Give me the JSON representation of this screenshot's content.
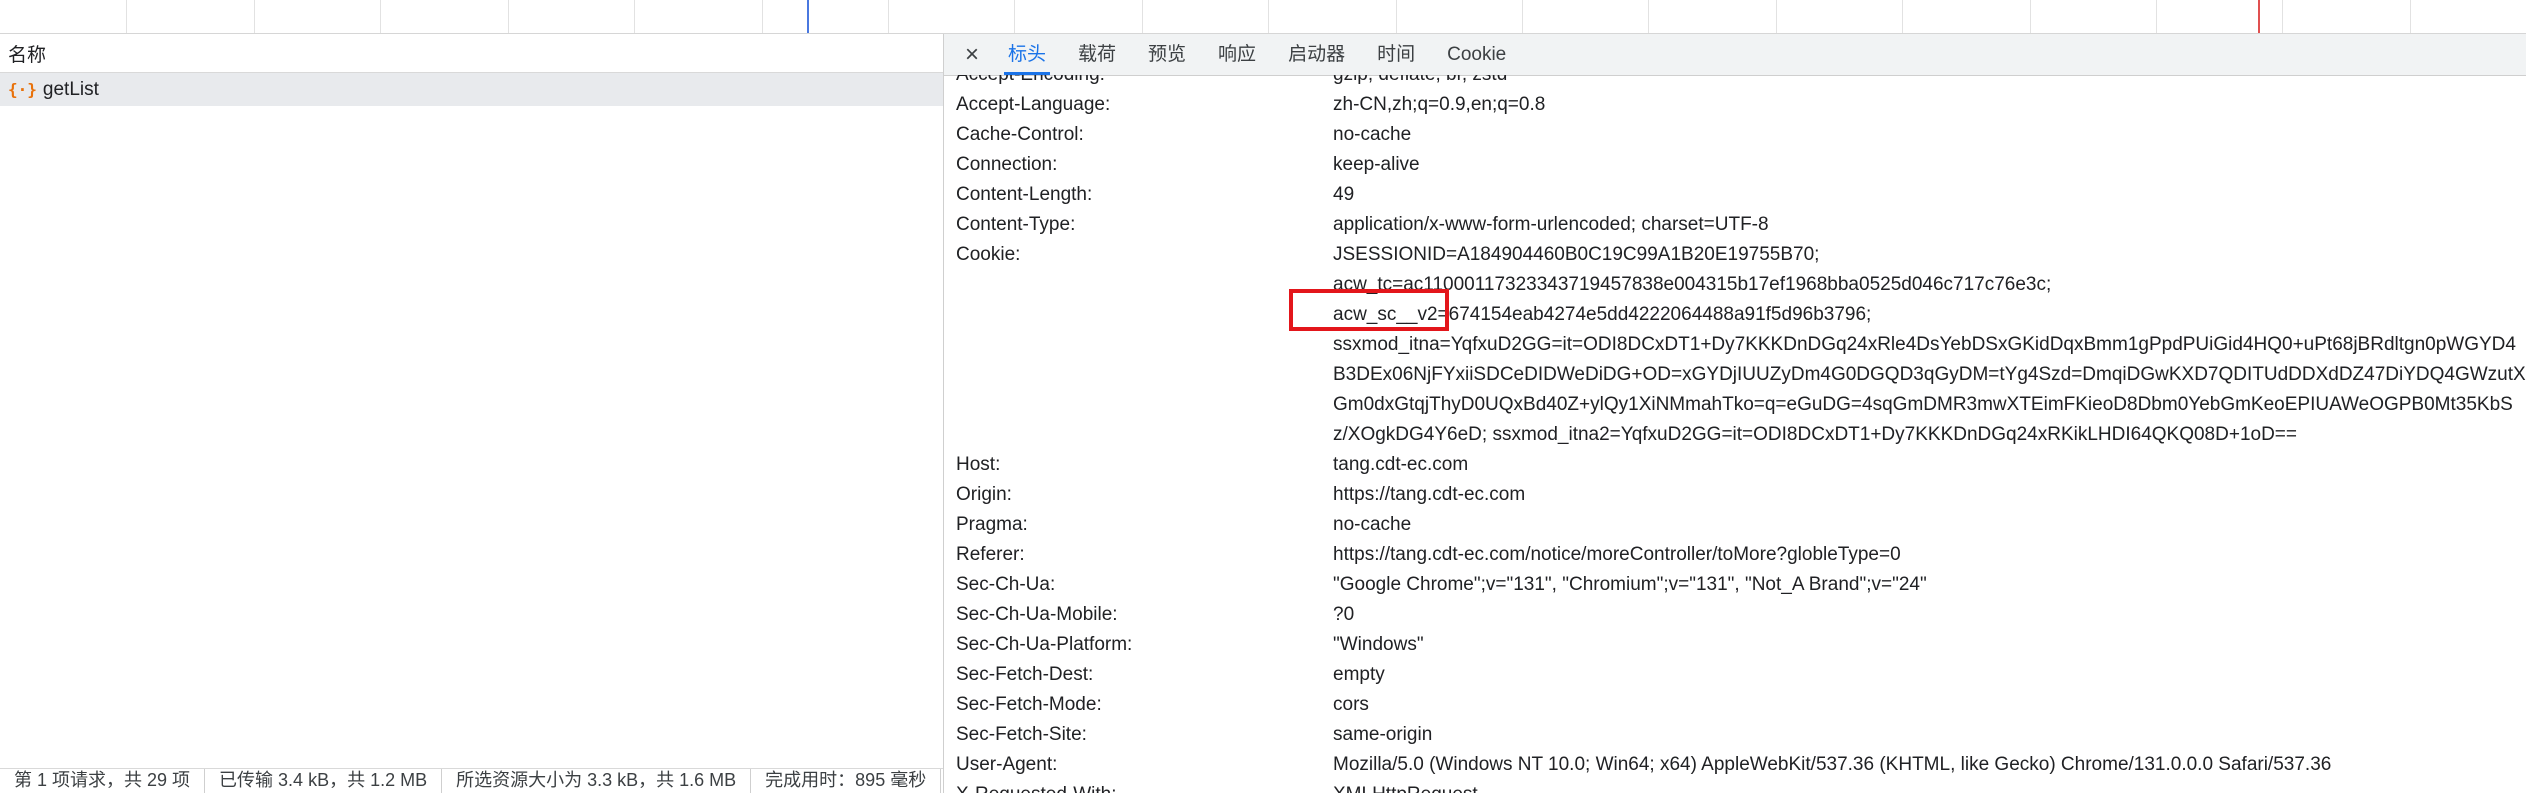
{
  "left": {
    "header": "名称",
    "request_name": "getList",
    "request_icon": "{·}",
    "status": [
      "第 1 项请求，共 29 项",
      "已传输 3.4 kB，共 1.2 MB",
      "所选资源大小为 3.3 kB，共 1.6 MB",
      "完成用时：895 毫秒"
    ]
  },
  "tabs": [
    "标头",
    "载荷",
    "预览",
    "响应",
    "启动器",
    "时间",
    "Cookie"
  ],
  "active_tab": "标头",
  "close_icon": "×",
  "headers": [
    {
      "key": "Accept-Encoding:",
      "value": "gzip, deflate, br, zstd"
    },
    {
      "key": "Accept-Language:",
      "value": "zh-CN,zh;q=0.9,en;q=0.8"
    },
    {
      "key": "Cache-Control:",
      "value": "no-cache"
    },
    {
      "key": "Connection:",
      "value": "keep-alive"
    },
    {
      "key": "Content-Length:",
      "value": "49"
    },
    {
      "key": "Content-Type:",
      "value": "application/x-www-form-urlencoded; charset=UTF-8"
    },
    {
      "key": "Cookie:",
      "value": "JSESSIONID=A184904460B0C19C99A1B20E19755B70;"
    },
    {
      "key": "Host:",
      "value": "tang.cdt-ec.com"
    },
    {
      "key": "Origin:",
      "value": "https://tang.cdt-ec.com"
    },
    {
      "key": "Pragma:",
      "value": "no-cache"
    },
    {
      "key": "Referer:",
      "value": "https://tang.cdt-ec.com/notice/moreController/toMore?globleType=0"
    },
    {
      "key": "Sec-Ch-Ua:",
      "value": "\"Google Chrome\";v=\"131\", \"Chromium\";v=\"131\", \"Not_A Brand\";v=\"24\""
    },
    {
      "key": "Sec-Ch-Ua-Mobile:",
      "value": "?0"
    },
    {
      "key": "Sec-Ch-Ua-Platform:",
      "value": "\"Windows\""
    },
    {
      "key": "Sec-Fetch-Dest:",
      "value": "empty"
    },
    {
      "key": "Sec-Fetch-Mode:",
      "value": "cors"
    },
    {
      "key": "Sec-Fetch-Site:",
      "value": "same-origin"
    },
    {
      "key": "User-Agent:",
      "value": "Mozilla/5.0 (Windows NT 10.0; Win64; x64) AppleWebKit/537.36 (KHTML, like Gecko) Chrome/131.0.0.0 Safari/537.36"
    },
    {
      "key": "X-Requested-With:",
      "value": "XMLHttpRequest"
    }
  ],
  "cookie_continuation": [
    "acw_tc=ac11000117323343719457838e004315b17ef1968bba0525d046c717c76e3c;",
    "acw_sc__v2=674154eab4274e5dd4222064488a91f5d96b3796;",
    "ssxmod_itna=YqfxuD2GG=it=ODI8DCxDT1+Dy7KKKDnDGq24xRle4DsYebDSxGKidDqxBmm1gPpdPUiGid4HQ0+uPt68jBRdltgn0pWGYD4",
    "B3DEx06NjFYxiiSDCeDIDWeDiDG+OD=xGYDjIUUZyDm4G0DGQD3qGyDM=tYg4Szd=DmqiDGwKXD7QDITUdDDXdDZ47DiYDQ4GWzutX",
    "Gm0dxGtqjThyD0UQxBd40Z+ylQy1XiNMmahTko=q=eGuDG=4sqGmDMR3mwXTEimFKieoD8Dbm0YebGmKeoEPIUAWeOGPB0Mt35KbS",
    "z/XOgkDG4Y6eD; ssxmod_itna2=YqfxuD2GG=it=ODI8DCxDT1+Dy7KKKDnDGq24xRKikLHDI64QKQ08D+1oD=="
  ],
  "colors": {
    "accent": "#1a73e8",
    "highlight": "#e3161b",
    "request_icon": "#e8710a"
  }
}
